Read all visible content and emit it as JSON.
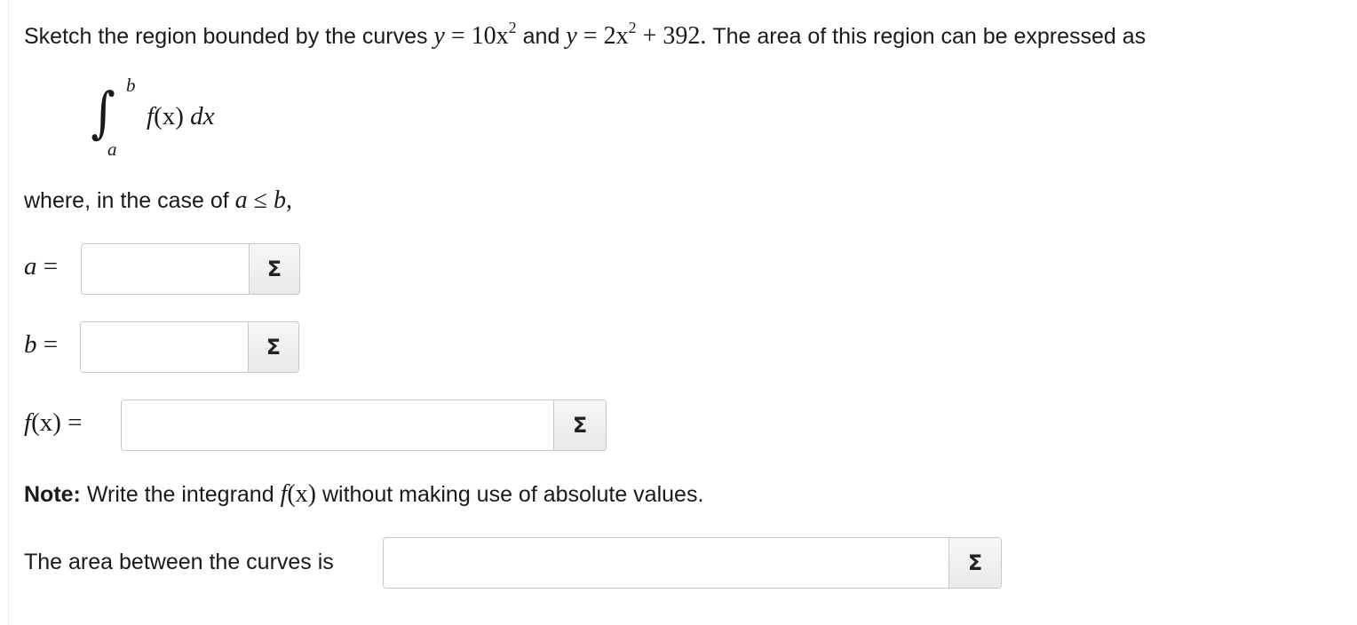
{
  "question": {
    "intro": "Sketch the region bounded by the curves",
    "curve1": {
      "lhs": "y",
      "eq": "=",
      "rhs": "10x",
      "exp": "2"
    },
    "conj": "and",
    "curve2": {
      "lhs": "y",
      "eq": "=",
      "rhs_a": "2x",
      "exp": "2",
      "rhs_b": "+ 392."
    },
    "tail": "The area of this region can be expressed as"
  },
  "integral": {
    "sign": "∫",
    "upper": "b",
    "lower": "a",
    "f": "f",
    "arg": "(x)",
    "d": "d",
    "dx": "x"
  },
  "where": {
    "text": "where, in the case of",
    "a": "a",
    "leq": "≤",
    "b": "b",
    "comma": ","
  },
  "fields": {
    "a": {
      "var": "a",
      "eq": "=",
      "value": ""
    },
    "b": {
      "var": "b",
      "eq": "=",
      "value": ""
    },
    "f": {
      "var": "f",
      "arg": "(x)",
      "eq": "=",
      "value": ""
    },
    "area": {
      "label": "The area between the curves is",
      "value": ""
    }
  },
  "sigma_button": {
    "symbol": "Σ"
  },
  "note": {
    "bold": "Note:",
    "pre": "Write the integrand",
    "f": "f",
    "arg": "(x)",
    "post": "without making use of absolute values."
  }
}
